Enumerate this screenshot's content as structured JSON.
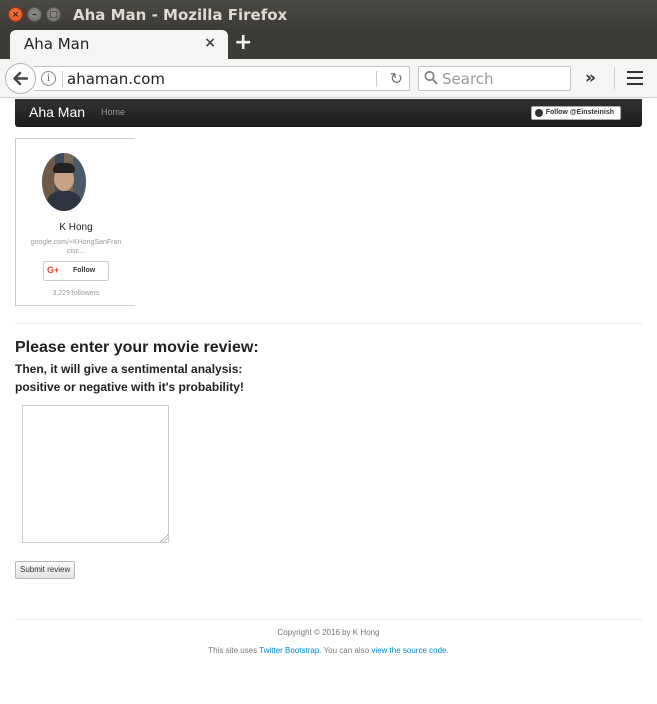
{
  "window": {
    "title": "Aha Man - Mozilla Firefox",
    "close_glyph": "×",
    "min_glyph": "–",
    "max_glyph": "□"
  },
  "tabs": [
    {
      "label": "Aha Man",
      "close_glyph": "×"
    }
  ],
  "new_tab_glyph": "+",
  "navbar": {
    "url": "ahaman.com",
    "info_glyph": "i",
    "reload_glyph": "↻",
    "search_placeholder": "Search",
    "overflow_glyph": "»"
  },
  "site": {
    "brand": "Aha Man",
    "nav_home": "Home",
    "github_follow": "Follow @Einsteinish"
  },
  "gplus_card": {
    "name": "K Hong",
    "profile_url": "google.com/+KHongSanFrancisc...",
    "follow_label": "Follow",
    "gplus_glyph": "G+",
    "followers": "3,229 followers"
  },
  "review": {
    "heading": "Please enter your movie review:",
    "subheading_line1": "Then, it will give a sentimental analysis:",
    "subheading_line2": "positive or negative with it's probability!",
    "textarea_value": "",
    "submit_label": "Submit review"
  },
  "footer": {
    "copyright": "Copyright © 2016 by K Hong",
    "prefix": "This site uses ",
    "bootstrap_link": "Twitter Bootstrap",
    "middle": ". You can also ",
    "source_link": "view the source code",
    "suffix": "."
  },
  "colors": {
    "titlebar": "#3c3b37",
    "close_button": "#df4a16",
    "site_nav": "#1b1b1b",
    "link": "#0088cc",
    "gplus_red": "#dd4b39"
  }
}
